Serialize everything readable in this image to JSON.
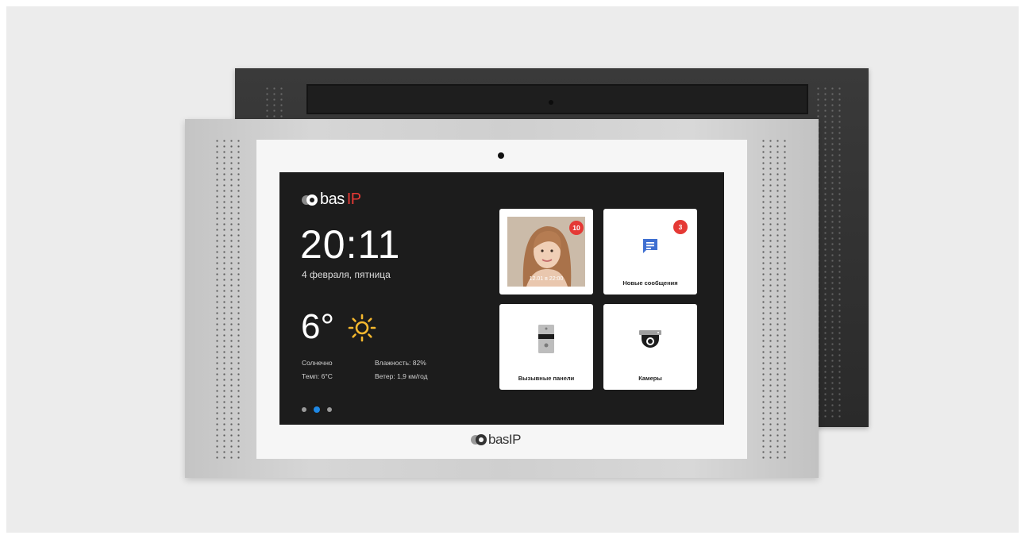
{
  "device": {
    "brand_prefix": "bas",
    "brand_suffix": "IP",
    "bottom_logo": "basIP"
  },
  "home": {
    "time": "20:11",
    "date": "4 февраля, пятница",
    "weather": {
      "temperature": "6°",
      "condition": "Солнечно",
      "temp_detail": "Темп: 6°C",
      "humidity": "Влажность: 82%",
      "wind": "Ветер: 1,9 км/год",
      "icon": "sun-icon"
    },
    "pager": {
      "pages": 3,
      "active": 2
    }
  },
  "tiles": [
    {
      "id": "intercom-history",
      "badge": "10",
      "photo_time": "12.01 в 22:00",
      "icon": "visitor-photo"
    },
    {
      "id": "messages",
      "label": "Новые сообщения",
      "badge": "3",
      "icon": "message-icon"
    },
    {
      "id": "call-panels",
      "label": "Вызывные панели",
      "icon": "call-panel-icon"
    },
    {
      "id": "cameras",
      "label": "Камеры",
      "icon": "camera-icon"
    }
  ],
  "colors": {
    "accent_blue": "#1e88e5",
    "badge_red": "#e53935",
    "screen_bg": "#1c1c1c"
  }
}
